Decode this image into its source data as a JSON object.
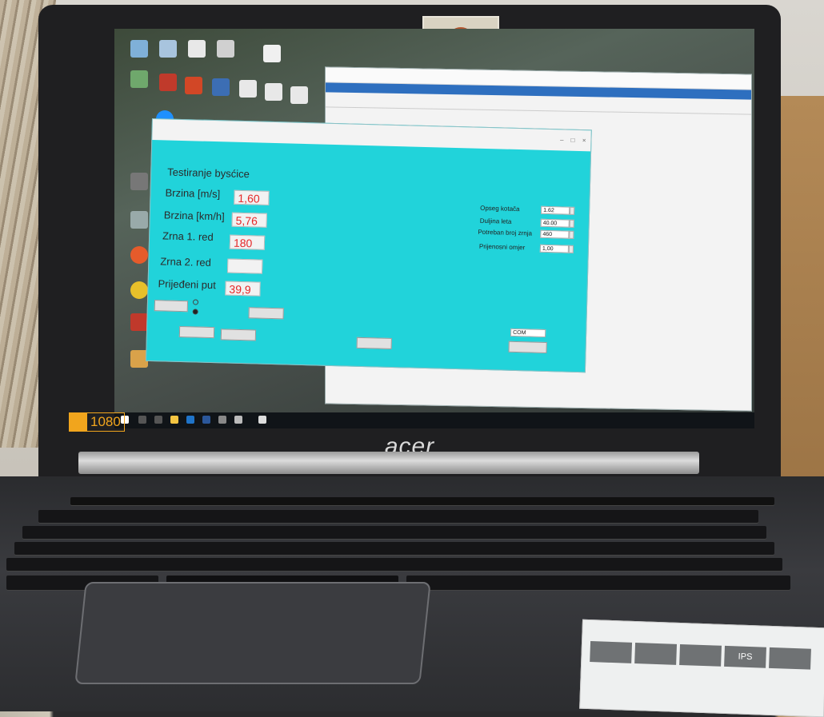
{
  "app": {
    "header": "Testiranje bysćice",
    "fields": [
      {
        "label": "Brzina [m/s]",
        "value": "1,60"
      },
      {
        "label": "Brzina [km/h]",
        "value": "5,76"
      },
      {
        "label": "Zrna 1. red",
        "value": "180"
      },
      {
        "label": "Zrna 2. red",
        "value": ""
      },
      {
        "label": "Prijeđeni put",
        "value": "39,9"
      }
    ],
    "params": [
      {
        "label": "Opseg kotača",
        "value": "1.62"
      },
      {
        "label": "Duljina leta",
        "value": "40.00"
      },
      {
        "label": "Potreban broj zrnja",
        "value": "460"
      },
      {
        "label": "Prijenosni omjer",
        "value": "1,00"
      }
    ],
    "bottom_field": {
      "value": "COM"
    }
  },
  "laptop": {
    "brand": "acer",
    "hd_badge": "1080"
  },
  "sticker": {
    "cells": [
      "IPS"
    ]
  }
}
